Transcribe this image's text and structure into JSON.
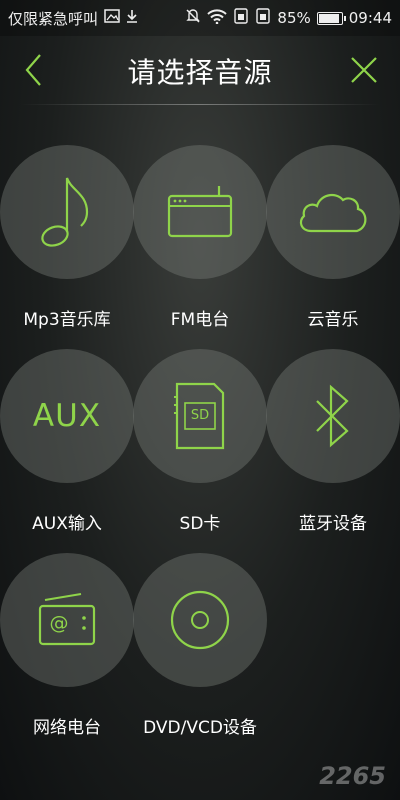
{
  "status_bar": {
    "carrier_text": "仅限紧急呼叫",
    "battery_percent": "85%",
    "battery_level": 0.85,
    "time": "09:44",
    "icons": [
      "image-icon",
      "download-icon",
      "mute-icon",
      "wifi-icon",
      "sim-icon",
      "sim-icon",
      "battery-icon"
    ]
  },
  "header": {
    "title": "请选择音源"
  },
  "sources": [
    {
      "label": "Mp3音乐库",
      "icon": "music-note-icon"
    },
    {
      "label": "FM电台",
      "icon": "radio-icon"
    },
    {
      "label": "云音乐",
      "icon": "cloud-icon"
    },
    {
      "label": "AUX输入",
      "icon": "aux-icon",
      "icon_text": "AUX"
    },
    {
      "label": "SD卡",
      "icon": "sd-card-icon",
      "icon_text": "SD"
    },
    {
      "label": "蓝牙设备",
      "icon": "bluetooth-icon"
    },
    {
      "label": "网络电台",
      "icon": "internet-radio-icon",
      "icon_text": "@"
    },
    {
      "label": "DVD/VCD设备",
      "icon": "disc-icon"
    }
  ],
  "watermark": "2265",
  "colors": {
    "accent": "#8fd44a",
    "circle": "#6b6f69"
  }
}
